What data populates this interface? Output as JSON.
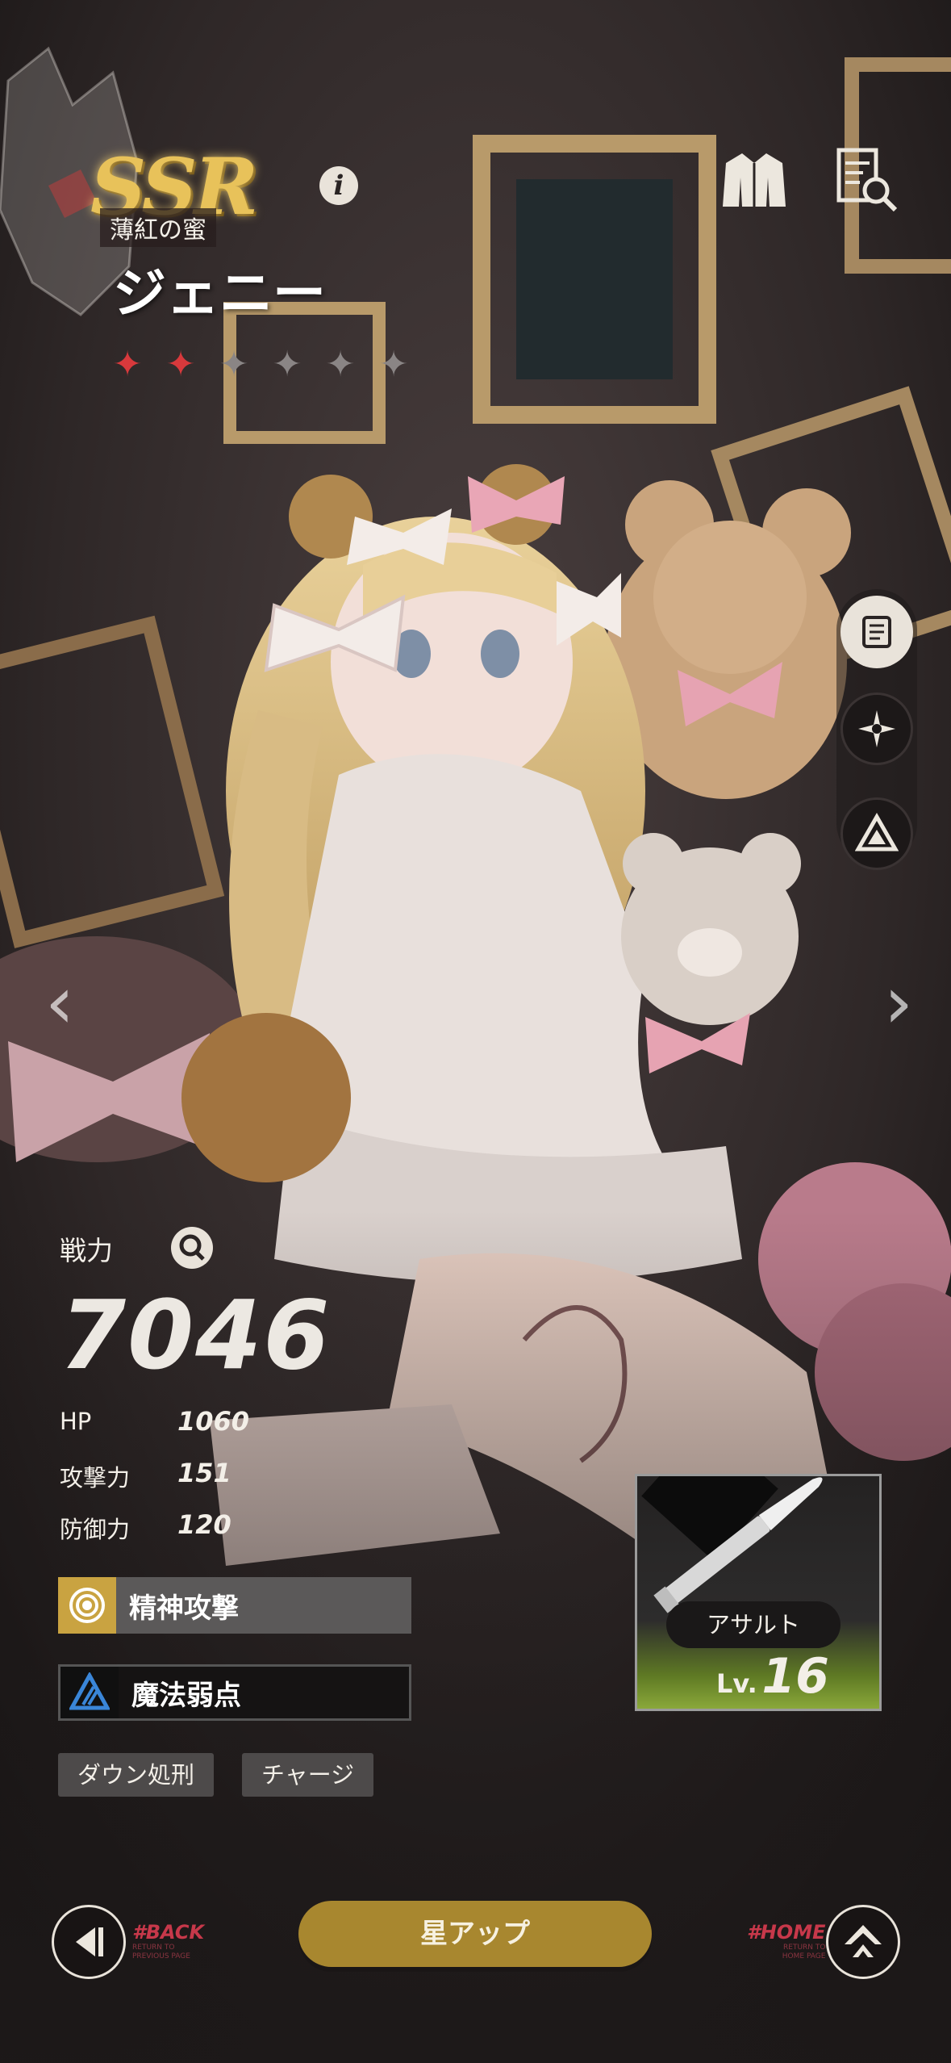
{
  "colors": {
    "accent_gold": "#a8872f",
    "rarity_gold": "#e8c25a",
    "star_active": "#d8393c",
    "star_inactive": "#8a8585",
    "weapon_level_green": "#8aa83a",
    "nav_red": "#c7384a"
  },
  "header": {
    "rarity": "SSR",
    "subtitle": "薄紅の蜜",
    "info_icon": "info-icon",
    "character_name": "ジェニー",
    "star_rating": {
      "filled": 2,
      "total": 6
    },
    "outfit_icon": "jacket-icon",
    "profile_search_icon": "document-search-icon"
  },
  "side_rail": [
    {
      "icon": "scroll-icon"
    },
    {
      "icon": "burst-icon"
    },
    {
      "icon": "triangle-emblem-icon"
    }
  ],
  "stats": {
    "power_label": "戦力",
    "power_value": "7046",
    "rows": [
      {
        "label": "HP",
        "value": "1060"
      },
      {
        "label": "攻撃力",
        "value": "151"
      },
      {
        "label": "防御力",
        "value": "120"
      }
    ]
  },
  "skills": {
    "attribute": "精神攻撃",
    "weakness": "魔法弱点"
  },
  "tags": [
    "ダウン処刑",
    "チャージ"
  ],
  "weapon": {
    "type": "アサルト",
    "level_label": "Lv.",
    "level": "16",
    "icon": "bullet-icon"
  },
  "bottom_bar": {
    "back_hash": "#BACK",
    "back_sub_1": "RETURN TO",
    "back_sub_2": "PREVIOUS PAGE",
    "star_up_label": "星アップ",
    "home_hash": "#HOME",
    "home_sub_1": "RETURN TO",
    "home_sub_2": "HOME PAGE"
  }
}
